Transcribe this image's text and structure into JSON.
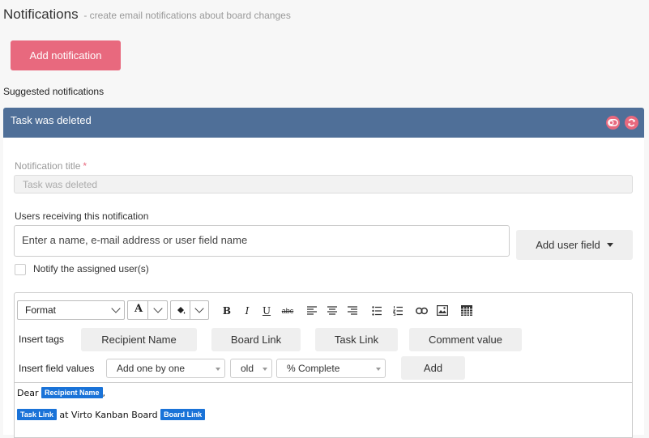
{
  "header": {
    "title": "Notifications",
    "subtitle": "- create email notifications about board changes",
    "add_button": "Add notification",
    "suggested_label": "Suggested notifications"
  },
  "panel": {
    "title": "Task was deleted",
    "icons": [
      "toggle-icon",
      "refresh-icon"
    ],
    "accent_color": "#4f6f98"
  },
  "form": {
    "title_label": "Notification title",
    "required_mark": "*",
    "title_value": "Task was deleted",
    "users_label": "Users receiving this notification",
    "users_placeholder": "Enter a name, e-mail address or user field name",
    "add_user_button": "Add user field",
    "notify_assigned_label": "Notify the assigned user(s)",
    "notify_assigned_checked": false
  },
  "editor": {
    "format_select": "Format",
    "insert_tags_label": "Insert tags",
    "tags": [
      "Recipient Name",
      "Board Link",
      "Task Link",
      "Comment value"
    ],
    "insert_fields_label": "Insert field values",
    "field_mode": "Add one by one",
    "field_version": "old",
    "field_name": "% Complete",
    "add_button": "Add",
    "content": {
      "line1_prefix": "Dear",
      "line1_chip": "Recipient Name",
      "line1_suffix": ",",
      "line2_chip1": "Task Link",
      "line2_text": "at Virto Kanban Board",
      "line2_chip2": "Board Link"
    },
    "chip_color": "#1a73d8"
  },
  "colors": {
    "brand_pink": "#e8697e"
  }
}
